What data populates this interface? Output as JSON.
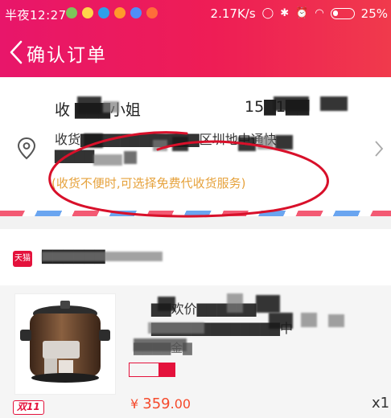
{
  "status_bar": {
    "time": "半夜12:27",
    "network_speed": "2.17K/s",
    "battery": "25%"
  },
  "header": {
    "title": "确认订单"
  },
  "address": {
    "name": "收 ▇▇▇小姐",
    "phone": "15▇1▇▇",
    "line1": "收货▇▇▇▇▇▇▇▇▇▇▇▇区圳地中通快",
    "line2": "▇▇▇▇",
    "service_note": "(收货不便时,可选择免费代收货服务)"
  },
  "shop": {
    "name": "▇▇▇▇▇▇"
  },
  "product": {
    "title": "▇▇欢价▇▇▇▇▇▇",
    "title_line2": "▇▇▇▇▇▇▇▇▇▇▇▇▇中",
    "sku": "▇▇▇▇金▇",
    "badge": "双11",
    "price_symbol": "¥",
    "price_int": "359",
    "price_dec": ".00",
    "quantity": "x1"
  },
  "colors": {
    "brand_gradient_start": "#e8166a",
    "brand_gradient_end": "#f03a4c",
    "price": "#f54a2c",
    "service_note": "#e6a23c",
    "annotation_circle": "#d8102a"
  }
}
